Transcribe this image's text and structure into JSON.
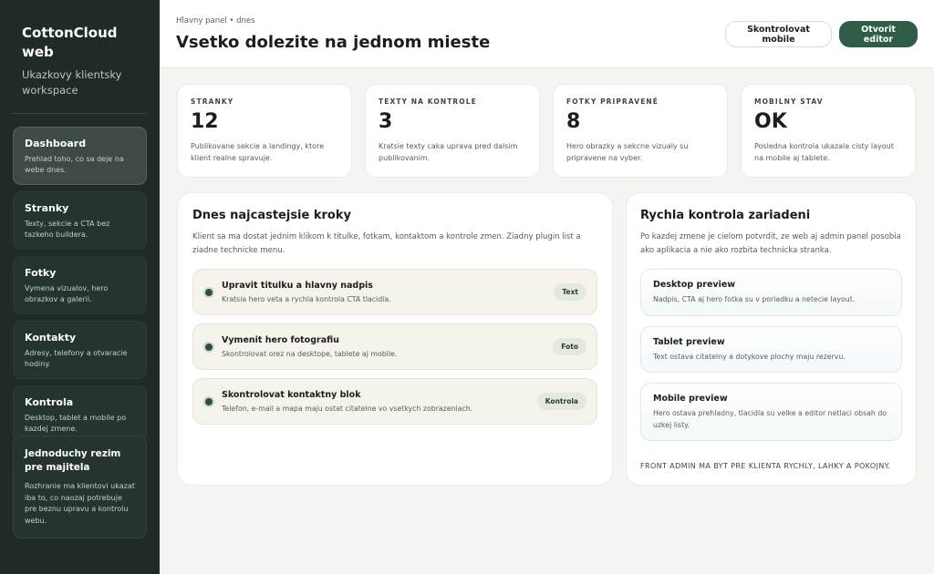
{
  "sidebar": {
    "brand_name": "CottonCloud web",
    "brand_subtitle": "Ukazkovy klientsky workspace",
    "items": [
      {
        "label": "Dashboard",
        "description": "Prehlad toho, co sa deje na webe dnes.",
        "active": true
      },
      {
        "label": "Stranky",
        "description": "Texty, sekcie a CTA bez tazkeho buildera.",
        "active": false
      },
      {
        "label": "Fotky",
        "description": "Vymena vizualov, hero obrazkov a galerii.",
        "active": false
      },
      {
        "label": "Kontakty",
        "description": "Adresy, telefony a otvaracie hodiny.",
        "active": false
      },
      {
        "label": "Kontrola",
        "description": "Desktop, tablet a mobile po kazdej zmene.",
        "active": false
      }
    ],
    "owner_box": {
      "title": "Jednoduchy rezim pre majitela",
      "description": "Rozhranie ma klientovi ukazat iba to, co naozaj potrebuje pre beznu upravu a kontrolu webu."
    }
  },
  "header": {
    "breadcrumb": "Hlavny panel • dnes",
    "title": "Vsetko dolezite na jednom mieste",
    "check_mobile_label": "Skontrolovat mobile",
    "open_editor_label": "Otvorit editor"
  },
  "stats": [
    {
      "label": "STRANKY",
      "value": "12",
      "description": "Publikovane sekcie a landingy, ktore klient realne spravuje."
    },
    {
      "label": "TEXTY NA KONTROLE",
      "value": "3",
      "description": "Kratsie texty caka uprava pred dalsim publikovanim."
    },
    {
      "label": "FOTKY PRIPRAVENÉ",
      "value": "8",
      "description": "Hero obrazky a sekcne vizualy su pripravene na vyber."
    },
    {
      "label": "MOBILNY STAV",
      "value": "OK",
      "description": "Posledna kontrola ukazala cisty layout na mobile aj tablete."
    }
  ],
  "steps_card": {
    "title": "Dnes najcastejsie kroky",
    "intro": "Klient sa ma dostat jednim klikom k titulke, fotkam, kontaktom a kontrole zmen. Ziadny plugin list a ziadne technicke menu.",
    "steps": [
      {
        "title": "Upravit titulku a hlavny nadpis",
        "description": "Kratsia hero veta a rychla kontrola CTA tlacidla.",
        "badge": "Text"
      },
      {
        "title": "Vymenit hero fotografiu",
        "description": "Skontrolovat orez na desktope, tablete aj mobile.",
        "badge": "Foto"
      },
      {
        "title": "Skontrolovat kontaktny blok",
        "description": "Telefon, e-mail a mapa maju ostat citatelne vo vsetkych zobrazeniach.",
        "badge": "Kontrola"
      }
    ]
  },
  "devices_card": {
    "title": "Rychla kontrola zariadeni",
    "intro": "Po kazdej zmene je cielom potvrdit, ze web aj admin panel posobia ako aplikacia a nie ako rozbita technicka stranka.",
    "devices": [
      {
        "title": "Desktop preview",
        "description": "Nadpis, CTA aj hero fotka su v poriadku a netecie layout."
      },
      {
        "title": "Tablet preview",
        "description": "Text ostava citatelny a dotykove plochy maju rezervu."
      },
      {
        "title": "Mobile preview",
        "description": "Hero ostava prehladny, tlacidla su velke a editor netlaci obsah do uzkej listy."
      }
    ],
    "footer": "FRONT ADMIN MA BYT PRE KLIENTA RYCHLY, LAHKY A POKOJNY."
  },
  "colors": {
    "sidebar_bg": "#1f2b26",
    "accent": "#2f5d47",
    "page_bg": "#f4f4f0"
  }
}
